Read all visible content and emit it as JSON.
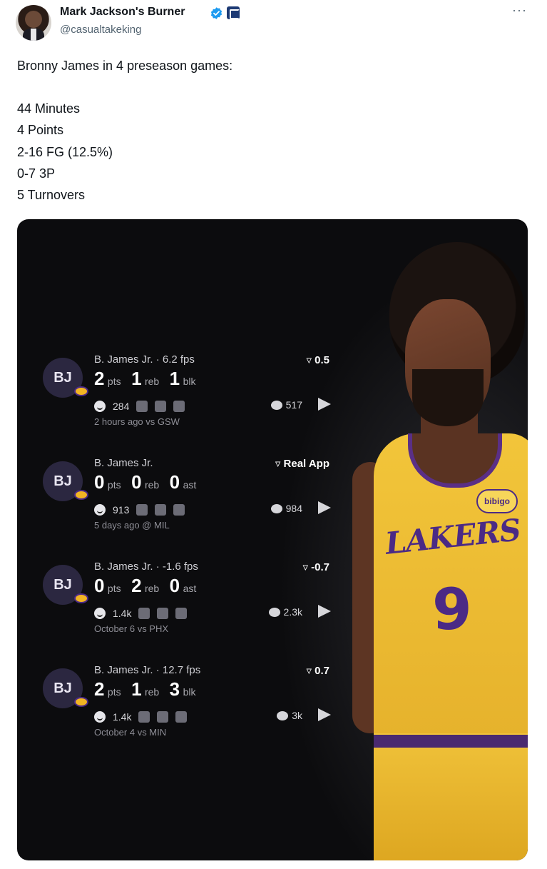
{
  "author": {
    "name": "Mark Jackson's Burner",
    "handle": "@casualtakeking",
    "more_label": "···"
  },
  "tweet": {
    "lines": [
      "Bronny James in 4 preseason games:",
      "44 Minutes",
      "4 Points",
      "2-16 FG (12.5%)",
      "0-7 3P",
      "5 Turnovers"
    ]
  },
  "media": {
    "jersey_text": "LAKERS",
    "jersey_number": "9",
    "sponsor": "bibigo",
    "cards": [
      {
        "initials": "BJ",
        "title": "B. James Jr. · 6.2 fps",
        "stat1_value": "2",
        "stat1_unit": "pts",
        "stat2_value": "1",
        "stat2_unit": "reb",
        "stat3_value": "1",
        "stat3_unit": "blk",
        "reactions": "284",
        "time": "2 hours ago vs GSW",
        "score": "▿ 0.5",
        "comments": "517"
      },
      {
        "initials": "BJ",
        "title": "B. James Jr.",
        "stat1_value": "0",
        "stat1_unit": "pts",
        "stat2_value": "0",
        "stat2_unit": "reb",
        "stat3_value": "0",
        "stat3_unit": "ast",
        "reactions": "913",
        "time": "5 days ago @ MIL",
        "score": "▿ Real App",
        "comments": "984"
      },
      {
        "initials": "BJ",
        "title": "B. James Jr. · -1.6 fps",
        "stat1_value": "0",
        "stat1_unit": "pts",
        "stat2_value": "2",
        "stat2_unit": "reb",
        "stat3_value": "0",
        "stat3_unit": "ast",
        "reactions": "1.4k",
        "time": "October 6 vs PHX",
        "score": "▿ -0.7",
        "comments": "2.3k"
      },
      {
        "initials": "BJ",
        "title": "B. James Jr. · 12.7 fps",
        "stat1_value": "2",
        "stat1_unit": "pts",
        "stat2_value": "1",
        "stat2_unit": "reb",
        "stat3_value": "3",
        "stat3_unit": "blk",
        "reactions": "1.4k",
        "time": "October 4 vs MIN",
        "score": "▿ 0.7",
        "comments": "3k"
      }
    ]
  },
  "colors": {
    "verified": "#1d9bf0",
    "jersey_gold": "#f2c53a",
    "lakers_purple": "#4b2a85"
  }
}
